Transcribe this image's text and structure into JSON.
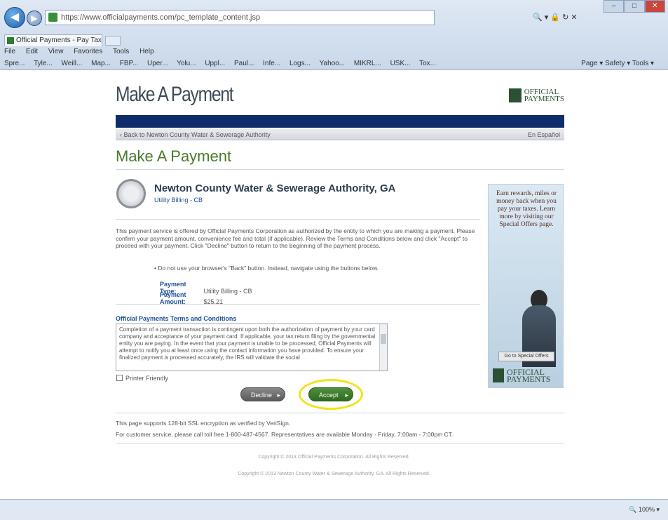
{
  "browser": {
    "address": "https://www.officialpayments.com/pc_template_content.jsp",
    "tab_title": "Official Payments - Pay Tax...",
    "menu": [
      "File",
      "Edit",
      "View",
      "Favorites",
      "Tools",
      "Help"
    ],
    "favorites": [
      "Spre...",
      "Tyle...",
      "Weill...",
      "Map...",
      "FBP...",
      "Uper...",
      "Yolu...",
      "Uppl...",
      "Paul...",
      "Infe...",
      "Logs...",
      "Yahoo...",
      "MIKRL...",
      "USK...",
      "Tox..."
    ],
    "toolbar_right": "Page ▾  Safety ▾  Tools ▾",
    "zoom": "🔍 100% ▾"
  },
  "header": {
    "brand_title": "Make A Payment",
    "logo_line1": "OFFICIAL",
    "logo_line2": "PAYMENTS"
  },
  "crumb": {
    "back_link": "‹ Back to Newton County Water & Sewerage Authority",
    "right": "En Español"
  },
  "main": {
    "page_title": "Make A Payment",
    "biller_name": "Newton County Water & Sewerage Authority, GA",
    "biller_sub": "Utility Billing - CB",
    "intro": "This payment service is offered by Official Payments Corporation as authorized by the entity to which you are making a payment. Please confirm your payment amount, convenience fee and total (if applicable). Review the Terms and Conditions below and click \"Accept\" to proceed with your payment. Click \"Decline\" button to return to the beginning of the payment process.",
    "note": "• Do not use your browser's \"Back\" button. Instead, navigate using the buttons below.",
    "payment_type_label": "Payment Type:",
    "payment_type_value": "Utility Billing - CB",
    "payment_amount_label": "Payment Amount:",
    "payment_amount_value": "$25.21",
    "terms_title": "Official Payments Terms and Conditions",
    "terms_text": "Completion of a payment transaction is contingent upon both the authorization of payment by your card company and acceptance of your payment card. If applicable, your tax return filing by the governmental entity you are paying. In the event that your payment is unable to be processed, Official Payments will attempt to notify you at least once using the contact information you have provided. To ensure your finalized payment is processed accurately, the IRS will validate the social",
    "printer_friendly": "Printer Friendly",
    "decline_label": "Decline",
    "accept_label": "Accept"
  },
  "ad": {
    "text": "Earn rewards, miles or money back when you pay your taxes. Learn more by visiting our Special Offers page.",
    "button": "Go to Special Offers",
    "logo_line1": "OFFICIAL",
    "logo_line2": "PAYMENTS"
  },
  "footer": {
    "ssl": "This page supports 128-bit SSL encryption as verified by VeriSign.",
    "service": "For customer service, please call toll free 1-800-487-4567. Representatives are available Monday - Friday, 7:00am - 7:00pm CT.",
    "copy1": "Copyright © 2013 Official Payments Corporation. All Rights Reserved.",
    "copy2": "Copyright © 2013 Newton County Water & Sewerage Authority, GA. All Rights Reserved."
  }
}
